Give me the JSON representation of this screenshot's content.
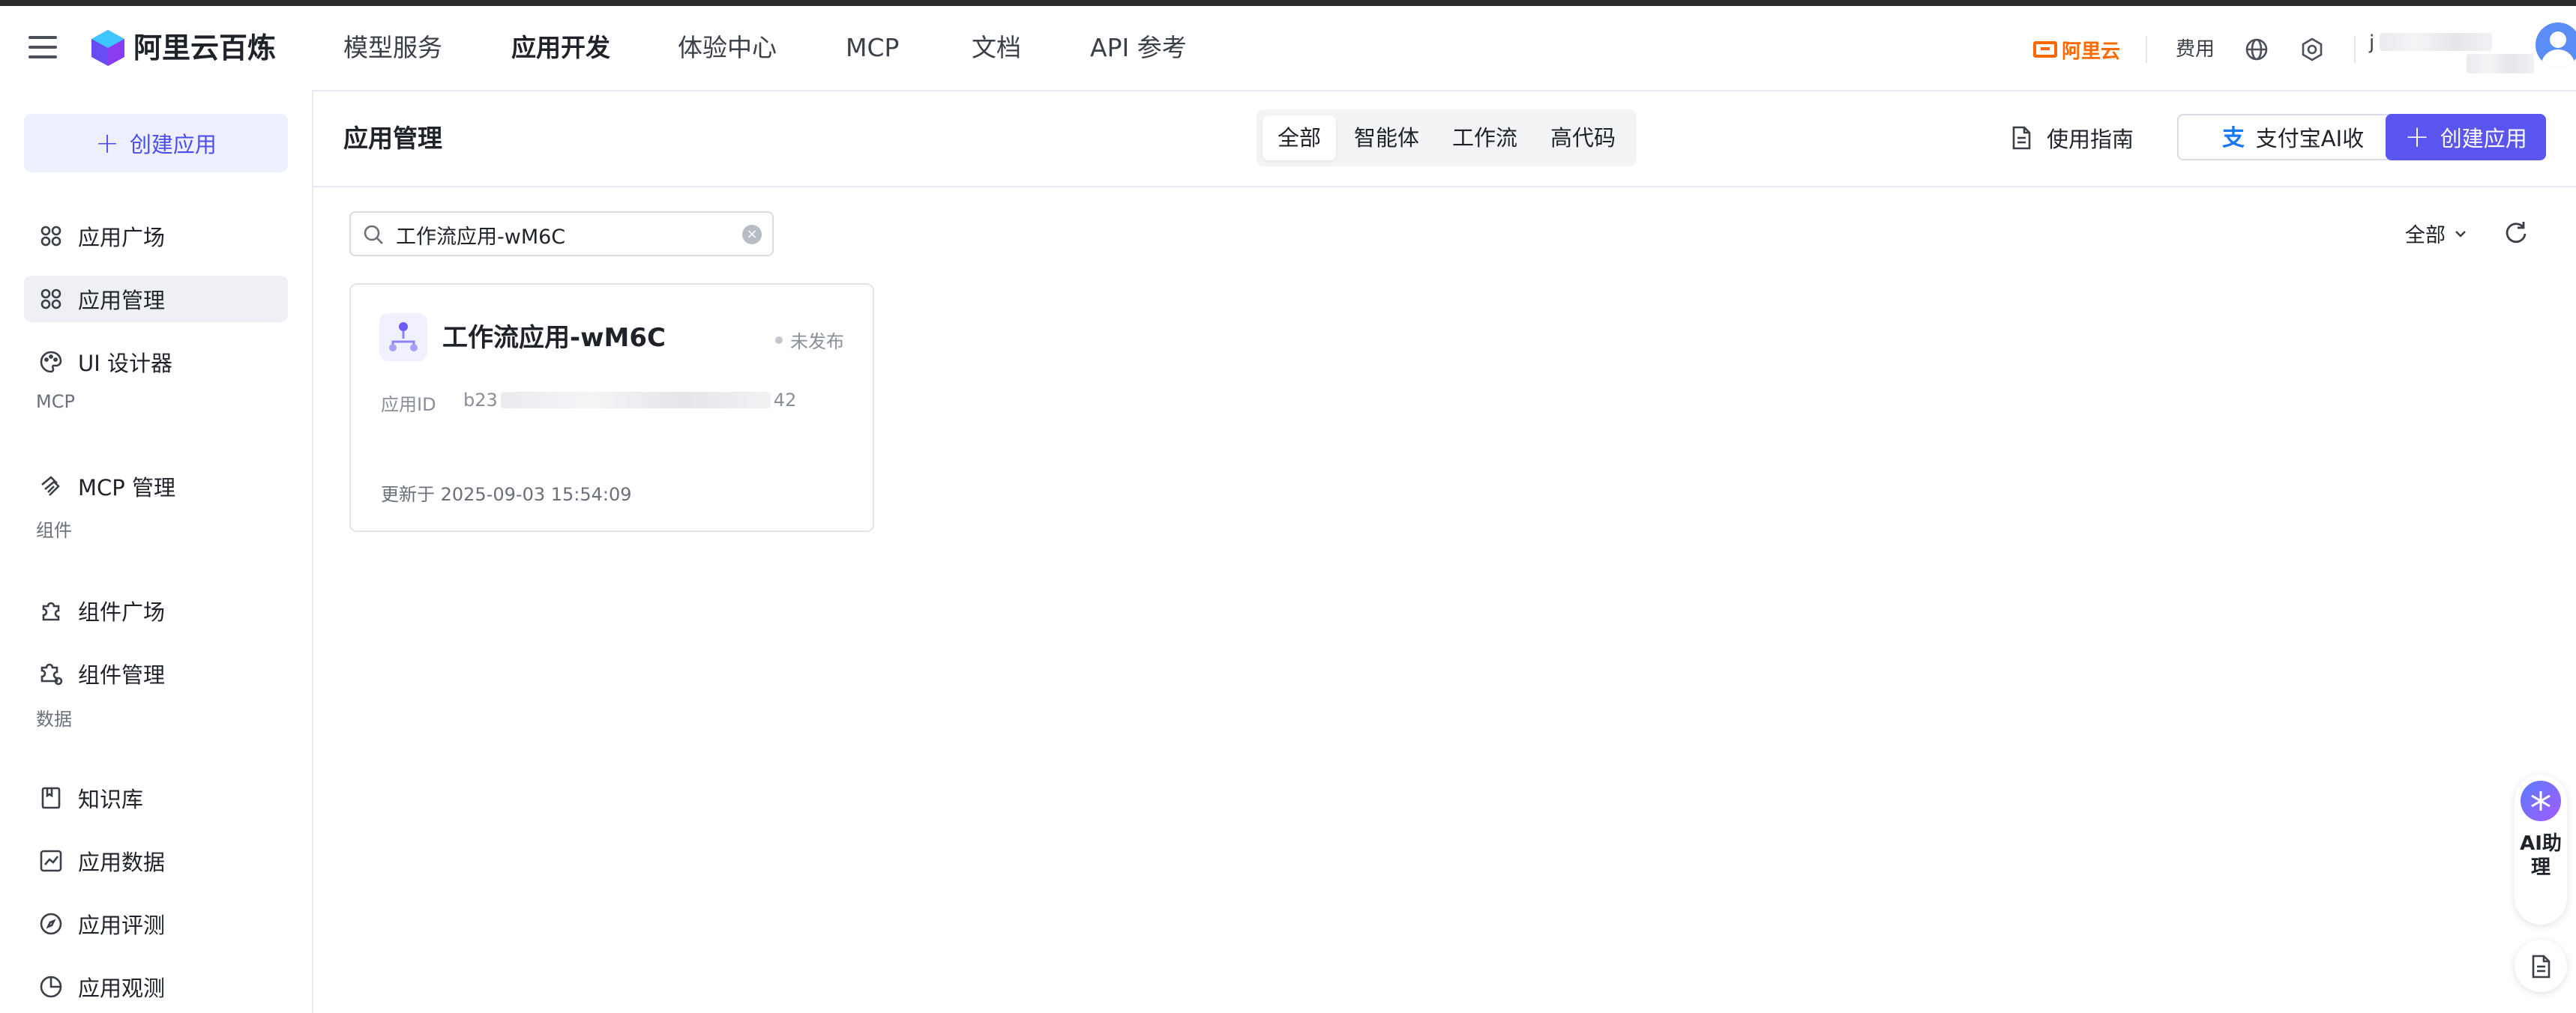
{
  "header": {
    "brand": "阿里云百炼",
    "nav": [
      "模型服务",
      "应用开发",
      "体验中心",
      "MCP",
      "文档",
      "API 参考"
    ],
    "active_nav": "应用开发",
    "aliyun_label": "阿里云",
    "fee_label": "费用",
    "user_initial": "j"
  },
  "sidebar": {
    "create_button": "创建应用",
    "items": {
      "app_square": "应用广场",
      "app_manage": "应用管理",
      "ui_designer": "UI 设计器",
      "mcp_manage": "MCP 管理",
      "comp_square": "组件广场",
      "comp_manage": "组件管理",
      "knowledge": "知识库",
      "app_data": "应用数据",
      "app_eval": "应用评测",
      "app_observe": "应用观测"
    },
    "groups": {
      "mcp": "MCP",
      "component": "组件",
      "data": "数据"
    }
  },
  "main": {
    "title": "应用管理",
    "tabs": [
      "全部",
      "智能体",
      "工作流",
      "高代码"
    ],
    "active_tab": "全部",
    "guide_label": "使用指南",
    "alipay_label": "支付宝AI收",
    "create_label": "创建应用",
    "search_value": "工作流应用-wM6C",
    "filter_label": "全部"
  },
  "card": {
    "name": "工作流应用-wM6C",
    "status": "未发布",
    "id_label": "应用ID",
    "id_prefix": "b23",
    "id_suffix": "42",
    "updated": "更新于 2025-09-03 15:54:09"
  },
  "float": {
    "ai_label": "AI助理"
  },
  "colors": {
    "primary": "#5b55f0",
    "aliyun_orange": "#ff6a00"
  }
}
